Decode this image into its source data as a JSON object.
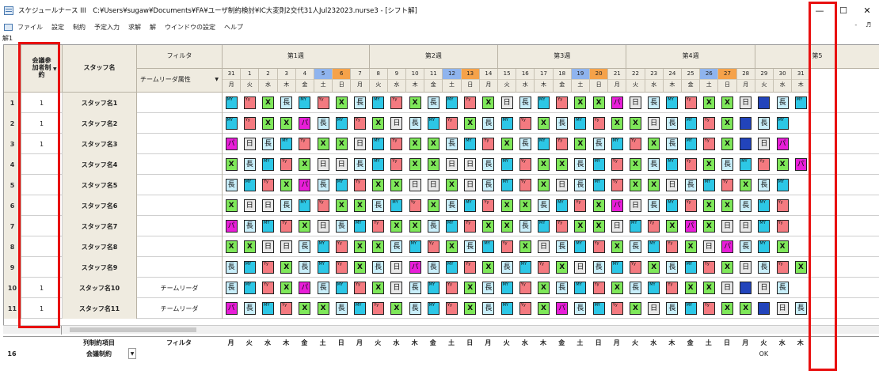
{
  "title": "スケジュールナース III　C:¥Users¥sugaw¥Documents¥FA¥ユーザ制約検討¥IC大変則2交代31人Jul232023.nurse3 - [シフト解]",
  "window_buttons": [
    "—",
    "☐",
    "✕"
  ],
  "menu": [
    "ファイル",
    "設定",
    "制約",
    "予定入力",
    "求解",
    "解",
    "ウインドウの設定",
    "ヘルプ"
  ],
  "mdi_controls": "- ♬",
  "doc_tab": "解1",
  "headers": {
    "meeting": "会議参加者制約",
    "meeting_arrow": "▼",
    "staff": "スタッフ名",
    "filter": "フィルタ",
    "team_attr": "チームリーダ属性",
    "filter_arrow": "▼"
  },
  "weeks": [
    "第1週",
    "第2週",
    "第3週",
    "第4週",
    "第5"
  ],
  "days": [
    {
      "n": "31",
      "w": "月"
    },
    {
      "n": "1",
      "w": "火"
    },
    {
      "n": "2",
      "w": "水"
    },
    {
      "n": "3",
      "w": "木"
    },
    {
      "n": "4",
      "w": "金"
    },
    {
      "n": "5",
      "w": "土"
    },
    {
      "n": "6",
      "w": "日"
    },
    {
      "n": "7",
      "w": "月"
    },
    {
      "n": "8",
      "w": "火"
    },
    {
      "n": "9",
      "w": "水"
    },
    {
      "n": "10",
      "w": "木"
    },
    {
      "n": "11",
      "w": "金"
    },
    {
      "n": "12",
      "w": "土"
    },
    {
      "n": "13",
      "w": "日"
    },
    {
      "n": "14",
      "w": "月"
    },
    {
      "n": "15",
      "w": "火"
    },
    {
      "n": "16",
      "w": "水"
    },
    {
      "n": "17",
      "w": "木"
    },
    {
      "n": "18",
      "w": "金"
    },
    {
      "n": "19",
      "w": "土"
    },
    {
      "n": "20",
      "w": "日"
    },
    {
      "n": "21",
      "w": "月"
    },
    {
      "n": "22",
      "w": "火"
    },
    {
      "n": "23",
      "w": "水"
    },
    {
      "n": "24",
      "w": "木"
    },
    {
      "n": "25",
      "w": "金"
    },
    {
      "n": "26",
      "w": "土"
    },
    {
      "n": "27",
      "w": "日"
    },
    {
      "n": "28",
      "w": "月"
    },
    {
      "n": "29",
      "w": "火"
    },
    {
      "n": "30",
      "w": "水"
    },
    {
      "n": "31",
      "w": "木"
    }
  ],
  "legend": {
    "x": "X",
    "d": "日",
    "c": "長",
    "my": "MY",
    "yy": "Yy",
    "p": "パ",
    "o": "O"
  },
  "rows": [
    {
      "num": "1",
      "meeting": "1",
      "staff": "スタッフ名1",
      "filter": "",
      "shifts": "my yy x c my yy x c my yy x c my yy x d c my yy x x p d c my yy x x d o c my"
    },
    {
      "num": "2",
      "meeting": "1",
      "staff": "スタッフ名2",
      "filter": "",
      "shifts": "my yy x x p c my yy x d c my yy x c my yy x c my yy x x d c my yy x o c my"
    },
    {
      "num": "3",
      "meeting": "1",
      "staff": "スタッフ名3",
      "filter": "",
      "shifts": "p d c my yy x x d my yy x x c my yy x c my yy x c my yy x c my yy x o d p"
    },
    {
      "num": "4",
      "meeting": "",
      "staff": "スタッフ名4",
      "filter": "",
      "shifts": "x c my yy x d d c my yy x x d d c my yy x x c my yy x c my yy x c my yy x p"
    },
    {
      "num": "5",
      "meeting": "",
      "staff": "スタッフ名5",
      "filter": "",
      "shifts": "c my yy x p c my yy x x d d x d c my yy x d c my yy x x d c my yy x c my"
    },
    {
      "num": "6",
      "meeting": "",
      "staff": "スタッフ名6",
      "filter": "",
      "shifts": "x d d c my yy x x c my yy x c my yy x x c my yy x p d c my yy x x c my yy"
    },
    {
      "num": "7",
      "meeting": "",
      "staff": "スタッフ名7",
      "filter": "",
      "shifts": "p c my yy x d c my yy x x c my yy x x c my yy x x d my yy x p x d d my yy"
    },
    {
      "num": "8",
      "meeting": "",
      "staff": "スタッフ名8",
      "filter": "",
      "shifts": "x x d d c my yy x x c my yy x c my yy x d c my yy x c my yy x d p c my x"
    },
    {
      "num": "9",
      "meeting": "",
      "staff": "スタッフ名9",
      "filter": "",
      "shifts": "c my yy x c my yy x c d p c my yy x c my yy x d c my yy x c my yy x d c yy x"
    },
    {
      "num": "10",
      "meeting": "1",
      "staff": "スタッフ名10",
      "filter": "チームリーダ",
      "shifts": "c my yy x p c my yy x d c my yy x c my yy x c my yy x c my yy x x d o d c"
    },
    {
      "num": "11",
      "meeting": "1",
      "staff": "スタッフ名11",
      "filter": "チームリーダ",
      "shifts": "p c my yy x x c my yy x c my yy x c my yy x p c my yy x d c my yy x x o d c"
    }
  ],
  "footer": {
    "label": "列制約項目",
    "filter": "フィルタ",
    "rownum": "16",
    "name": "会議制約",
    "dropdown": "▼",
    "week_days": [
      "月",
      "火",
      "水",
      "木",
      "金",
      "土",
      "日",
      "月",
      "火",
      "水",
      "木",
      "金",
      "土",
      "日",
      "月",
      "火",
      "水",
      "木",
      "金",
      "土",
      "日",
      "月",
      "火",
      "水",
      "木",
      "金",
      "土",
      "日",
      "月",
      "火",
      "水",
      "木"
    ],
    "ok": "OK"
  }
}
